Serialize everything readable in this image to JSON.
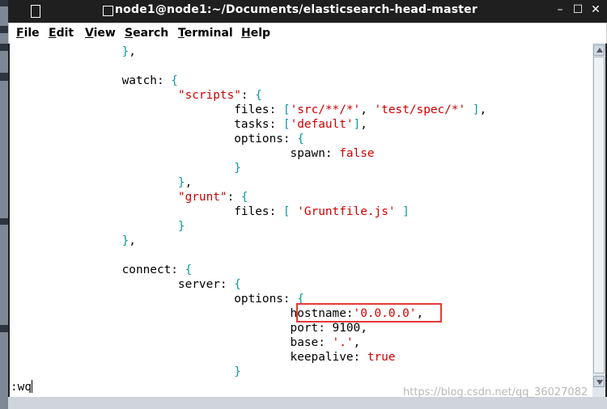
{
  "window": {
    "title": "node1@node1:~/Documents/elasticsearch-head-master",
    "minimize": "–",
    "maximize": "☐",
    "close": "✕"
  },
  "menu": [
    {
      "first": "F",
      "rest": "ile"
    },
    {
      "first": "E",
      "rest": "dit"
    },
    {
      "first": "V",
      "rest": "iew"
    },
    {
      "first": "S",
      "rest": "earch"
    },
    {
      "first": "T",
      "rest": "erminal"
    },
    {
      "first": "H",
      "rest": "elp"
    }
  ],
  "code_lines": [
    [
      {
        "t": "                }",
        "c": "b"
      },
      {
        "t": ",",
        "c": "k"
      }
    ],
    [],
    [
      {
        "t": "                watch: ",
        "c": "k"
      },
      {
        "t": "{",
        "c": "b"
      }
    ],
    [
      {
        "t": "                        ",
        "c": "k"
      },
      {
        "t": "\"scripts\"",
        "c": "s"
      },
      {
        "t": ": ",
        "c": "k"
      },
      {
        "t": "{",
        "c": "b"
      }
    ],
    [
      {
        "t": "                                files: ",
        "c": "k"
      },
      {
        "t": "[",
        "c": "b"
      },
      {
        "t": "'src/**/*'",
        "c": "s"
      },
      {
        "t": ", ",
        "c": "k"
      },
      {
        "t": "'test/spec/*'",
        "c": "s"
      },
      {
        "t": " ]",
        "c": "b"
      },
      {
        "t": ",",
        "c": "k"
      }
    ],
    [
      {
        "t": "                                tasks: ",
        "c": "k"
      },
      {
        "t": "[",
        "c": "b"
      },
      {
        "t": "'default'",
        "c": "s"
      },
      {
        "t": "]",
        "c": "b"
      },
      {
        "t": ",",
        "c": "k"
      }
    ],
    [
      {
        "t": "                                options: ",
        "c": "k"
      },
      {
        "t": "{",
        "c": "b"
      }
    ],
    [
      {
        "t": "                                        spawn: ",
        "c": "k"
      },
      {
        "t": "false",
        "c": "s"
      }
    ],
    [
      {
        "t": "                                }",
        "c": "b"
      }
    ],
    [
      {
        "t": "                        }",
        "c": "b"
      },
      {
        "t": ",",
        "c": "k"
      }
    ],
    [
      {
        "t": "                        ",
        "c": "k"
      },
      {
        "t": "\"grunt\"",
        "c": "s"
      },
      {
        "t": ": ",
        "c": "k"
      },
      {
        "t": "{",
        "c": "b"
      }
    ],
    [
      {
        "t": "                                files: ",
        "c": "k"
      },
      {
        "t": "[",
        "c": "b"
      },
      {
        "t": " 'Gruntfile.js'",
        "c": "s"
      },
      {
        "t": " ]",
        "c": "b"
      }
    ],
    [
      {
        "t": "                        }",
        "c": "b"
      }
    ],
    [
      {
        "t": "                }",
        "c": "b"
      },
      {
        "t": ",",
        "c": "k"
      }
    ],
    [],
    [
      {
        "t": "                connect: ",
        "c": "k"
      },
      {
        "t": "{",
        "c": "b"
      }
    ],
    [
      {
        "t": "                        server: ",
        "c": "k"
      },
      {
        "t": "{",
        "c": "b"
      }
    ],
    [
      {
        "t": "                                options: ",
        "c": "k"
      },
      {
        "t": "{",
        "c": "b"
      }
    ],
    [
      {
        "t": "                                        hostname:",
        "c": "k"
      },
      {
        "t": "'0.0.0.0'",
        "c": "s"
      },
      {
        "t": ",",
        "c": "k"
      }
    ],
    [
      {
        "t": "                                        port: 9100,",
        "c": "k"
      }
    ],
    [
      {
        "t": "                                        base: ",
        "c": "k"
      },
      {
        "t": "'.'",
        "c": "s"
      },
      {
        "t": ",",
        "c": "k"
      }
    ],
    [
      {
        "t": "                                        keepalive: ",
        "c": "k"
      },
      {
        "t": "true",
        "c": "s"
      }
    ],
    [
      {
        "t": "                                }",
        "c": "b"
      }
    ]
  ],
  "command_line": ":wq",
  "watermark": "https://blog.csdn.net/qq_36027082"
}
